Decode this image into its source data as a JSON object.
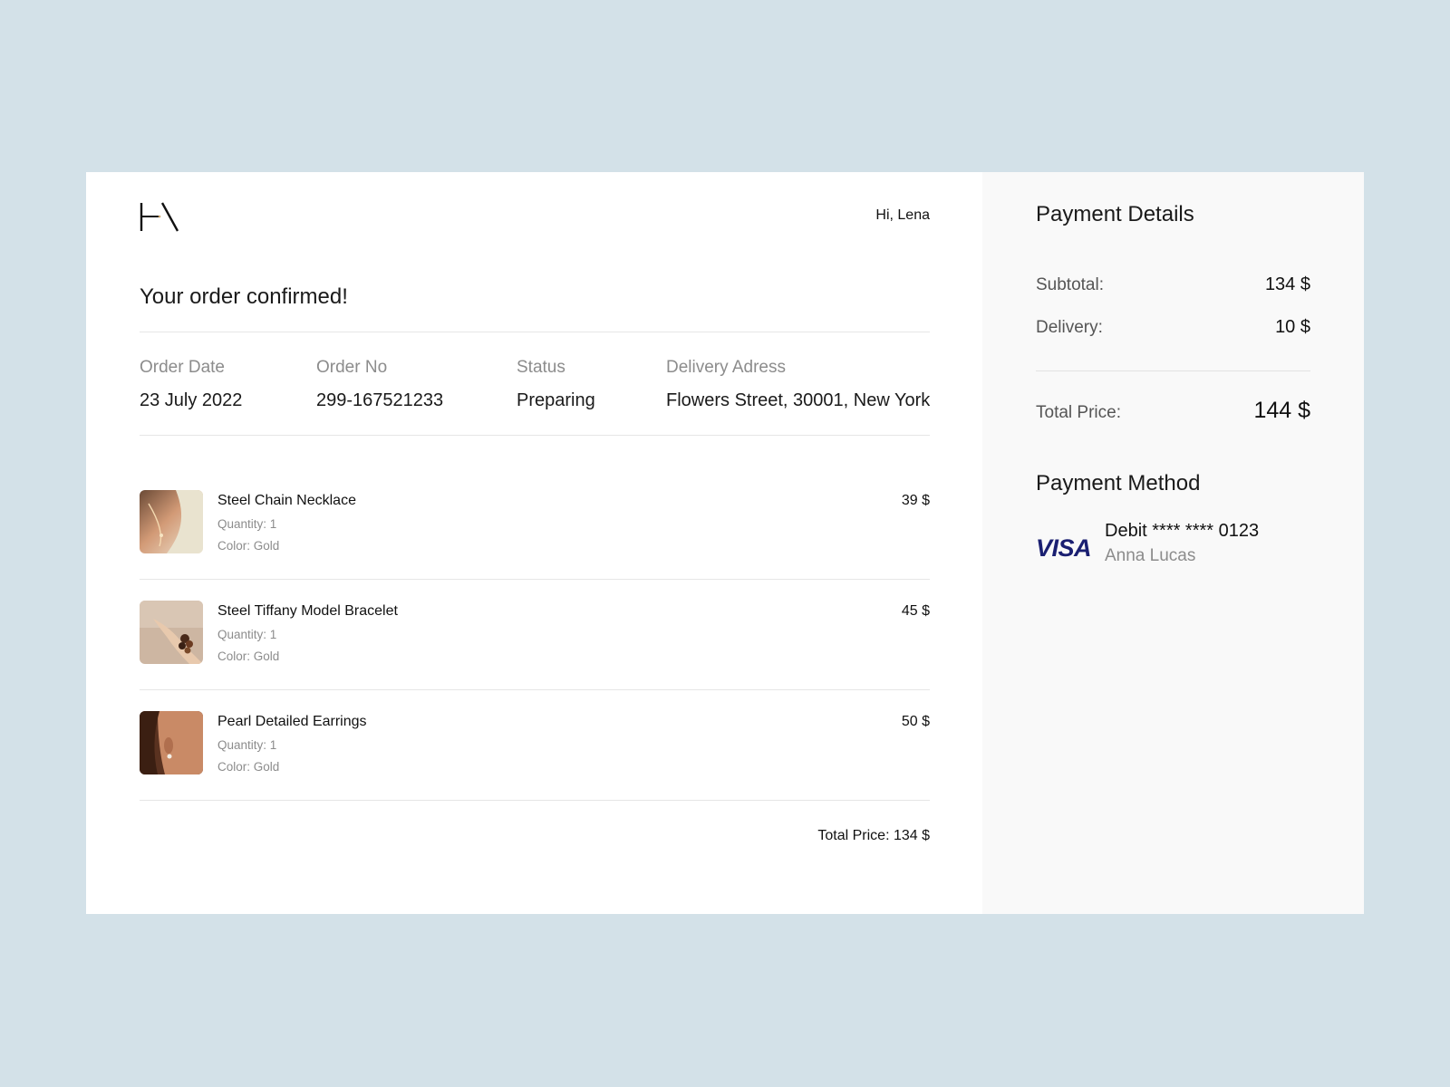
{
  "header": {
    "greeting": "Hi, Lena",
    "logo_icon": "brand-logo-icon"
  },
  "order": {
    "title": "Your order confirmed!",
    "meta": [
      {
        "label": "Order Date",
        "value": "23 July 2022"
      },
      {
        "label": "Order No",
        "value": "299-167521233"
      },
      {
        "label": "Status",
        "value": "Preparing"
      },
      {
        "label": "Delivery Adress",
        "value": "Flowers Street, 30001, New York"
      }
    ],
    "items": [
      {
        "name": "Steel Chain Necklace",
        "quantity": "Quantity: 1",
        "color": "Color: Gold",
        "price": "39 $",
        "image_icon": "necklace-image"
      },
      {
        "name": "Steel Tiffany Model Bracelet",
        "quantity": "Quantity: 1",
        "color": "Color: Gold",
        "price": "45 $",
        "image_icon": "bracelet-image"
      },
      {
        "name": "Pearl Detailed Earrings",
        "quantity": "Quantity: 1",
        "color": "Color: Gold",
        "price": "50 $",
        "image_icon": "earrings-image"
      }
    ],
    "total": "Total Price: 134 $"
  },
  "payment_details": {
    "title": "Payment Details",
    "subtotal_label": "Subtotal:",
    "subtotal_value": "134 $",
    "delivery_label": "Delivery:",
    "delivery_value": "10 $",
    "total_label": "Total Price:",
    "total_value": "144 $"
  },
  "payment_method": {
    "title": "Payment Method",
    "brand": "VISA",
    "card": "Debit **** **** 0123",
    "holder": "Anna Lucas"
  },
  "colors": {
    "background": "#d3e1e8",
    "card": "#ffffff",
    "aside": "#f9f9f9",
    "visa": "#1a1f71",
    "muted": "#8c8c8c"
  }
}
